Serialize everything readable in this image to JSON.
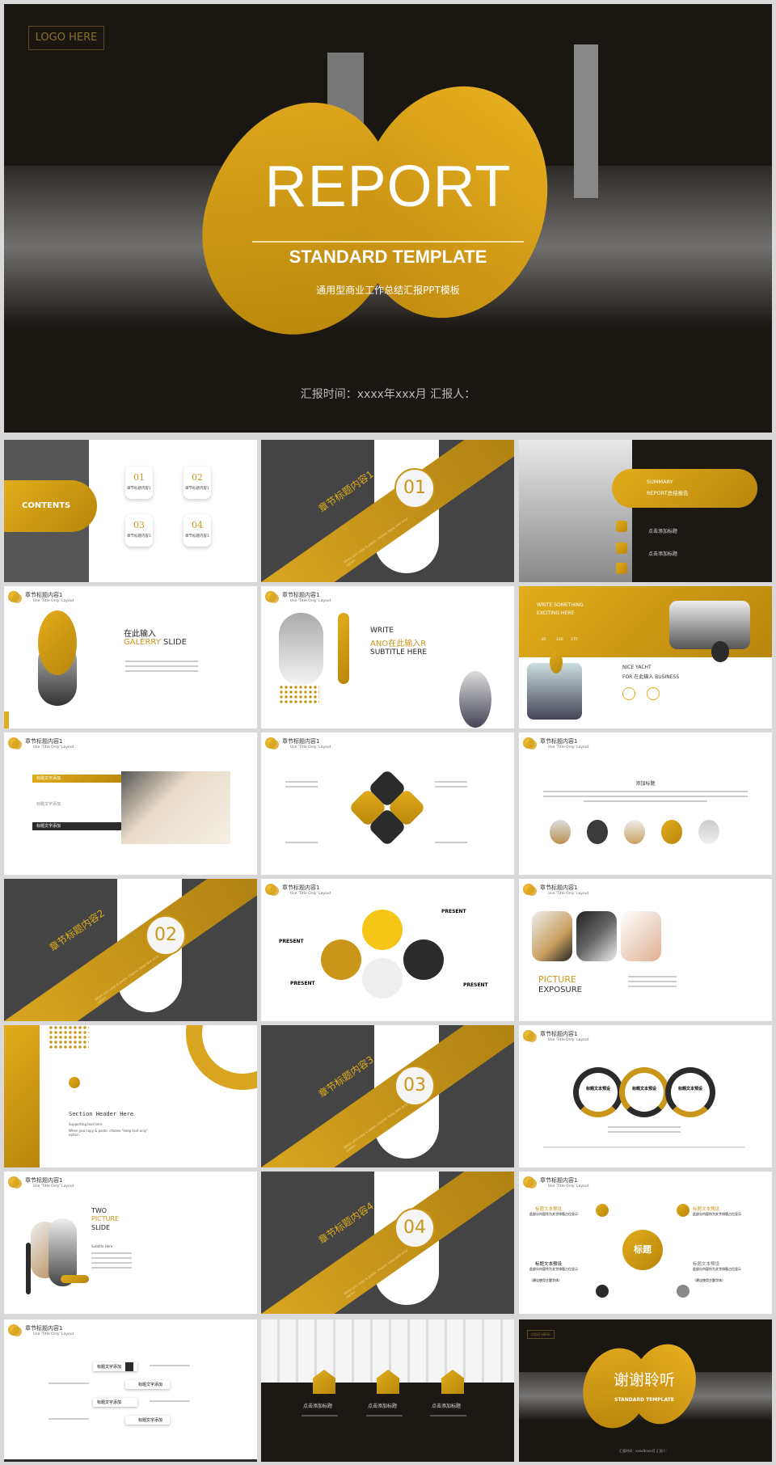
{
  "hero": {
    "logo": "LOGO HERE",
    "title": "REPORT",
    "subtitle": "STANDARD TEMPLATE",
    "caption": "通用型商业工作总结汇报PPT模板",
    "footer": "汇报时间：xxxx年xxx月    汇报人："
  },
  "common": {
    "chapter": "章节标题内容1",
    "layout": "Use 'Title Only' Layout",
    "copy_hint": "When you copy & paste, choose 'keep text only' option"
  },
  "contents": {
    "title": "CONTENTS",
    "items": [
      {
        "num": "01",
        "label": "章节标题内容1"
      },
      {
        "num": "02",
        "label": "章节标题内容1"
      },
      {
        "num": "03",
        "label": "章节标题内容1"
      },
      {
        "num": "04",
        "label": "章节标题内容1"
      }
    ]
  },
  "sections": [
    {
      "title": "章节标题内容1",
      "num": "01"
    },
    {
      "title": "章节标题内容2",
      "num": "02"
    },
    {
      "title": "章节标题内容3",
      "num": "03"
    },
    {
      "title": "章节标题内容4",
      "num": "04"
    }
  ],
  "summary": {
    "line1": "SUMMARY",
    "line2": "REPORT总结报告",
    "items": [
      "点击添加标题",
      "点击添加标题"
    ]
  },
  "gallery": {
    "line1": "在此输入",
    "line2a": "GALERRY",
    "line2b": "SLIDE"
  },
  "write": {
    "line1": "WRITE",
    "line2": "ANO在此输入R",
    "line3": "SUBTITLE HERE"
  },
  "exciting": {
    "title1": "WRITE SOMETHING",
    "title2": "EXCITING HERE",
    "stats": [
      "85",
      "120",
      "175"
    ],
    "yacht1": "NICE YACHT",
    "yacht2": "FOR 在此输入 BUSINESS"
  },
  "list3": {
    "items": [
      "标题文字添加",
      "标题文字添加",
      "标题文字添加"
    ]
  },
  "add_title": {
    "title": "添加标题"
  },
  "present": {
    "labels": [
      "PRESENT",
      "PRESENT",
      "PRESENT",
      "PRESENT"
    ]
  },
  "picture": {
    "line1": "PICTURE",
    "line2": "EXPOSURE"
  },
  "section_header": {
    "title": "Section Header Here",
    "support": "Supporting text here",
    "hint": "When you copy & paste, choose \"keep text only\" option."
  },
  "rings": {
    "labels": [
      "标题文本预设",
      "标题文本预设",
      "标题文本预设"
    ]
  },
  "two_picture": {
    "l1": "TWO",
    "l2": "PICTURE",
    "l3": "SLIDE",
    "sub": "Subtitle Here"
  },
  "hub": {
    "center": "标题",
    "title": "标题文本预设",
    "desc": "此部分内容作为文字排版占位显示",
    "note": "（建议使用主题字体）"
  },
  "list4": {
    "items": [
      "标题文字添加",
      "标题文字添加",
      "标题文字添加",
      "标题文字添加"
    ]
  },
  "keyboard": {
    "items": [
      "点击添加标题",
      "点击添加标题",
      "点击添加标题"
    ]
  },
  "thanks": {
    "logo": "LOGO HERE",
    "title": "谢谢聆听",
    "subtitle": "STANDARD TEMPLATE",
    "footer": "汇报时间：xxxx年xxx月    汇报人："
  },
  "colors": {
    "gold": "#c9961a",
    "dark": "#1a1612",
    "grey": "#4a4a4a"
  }
}
